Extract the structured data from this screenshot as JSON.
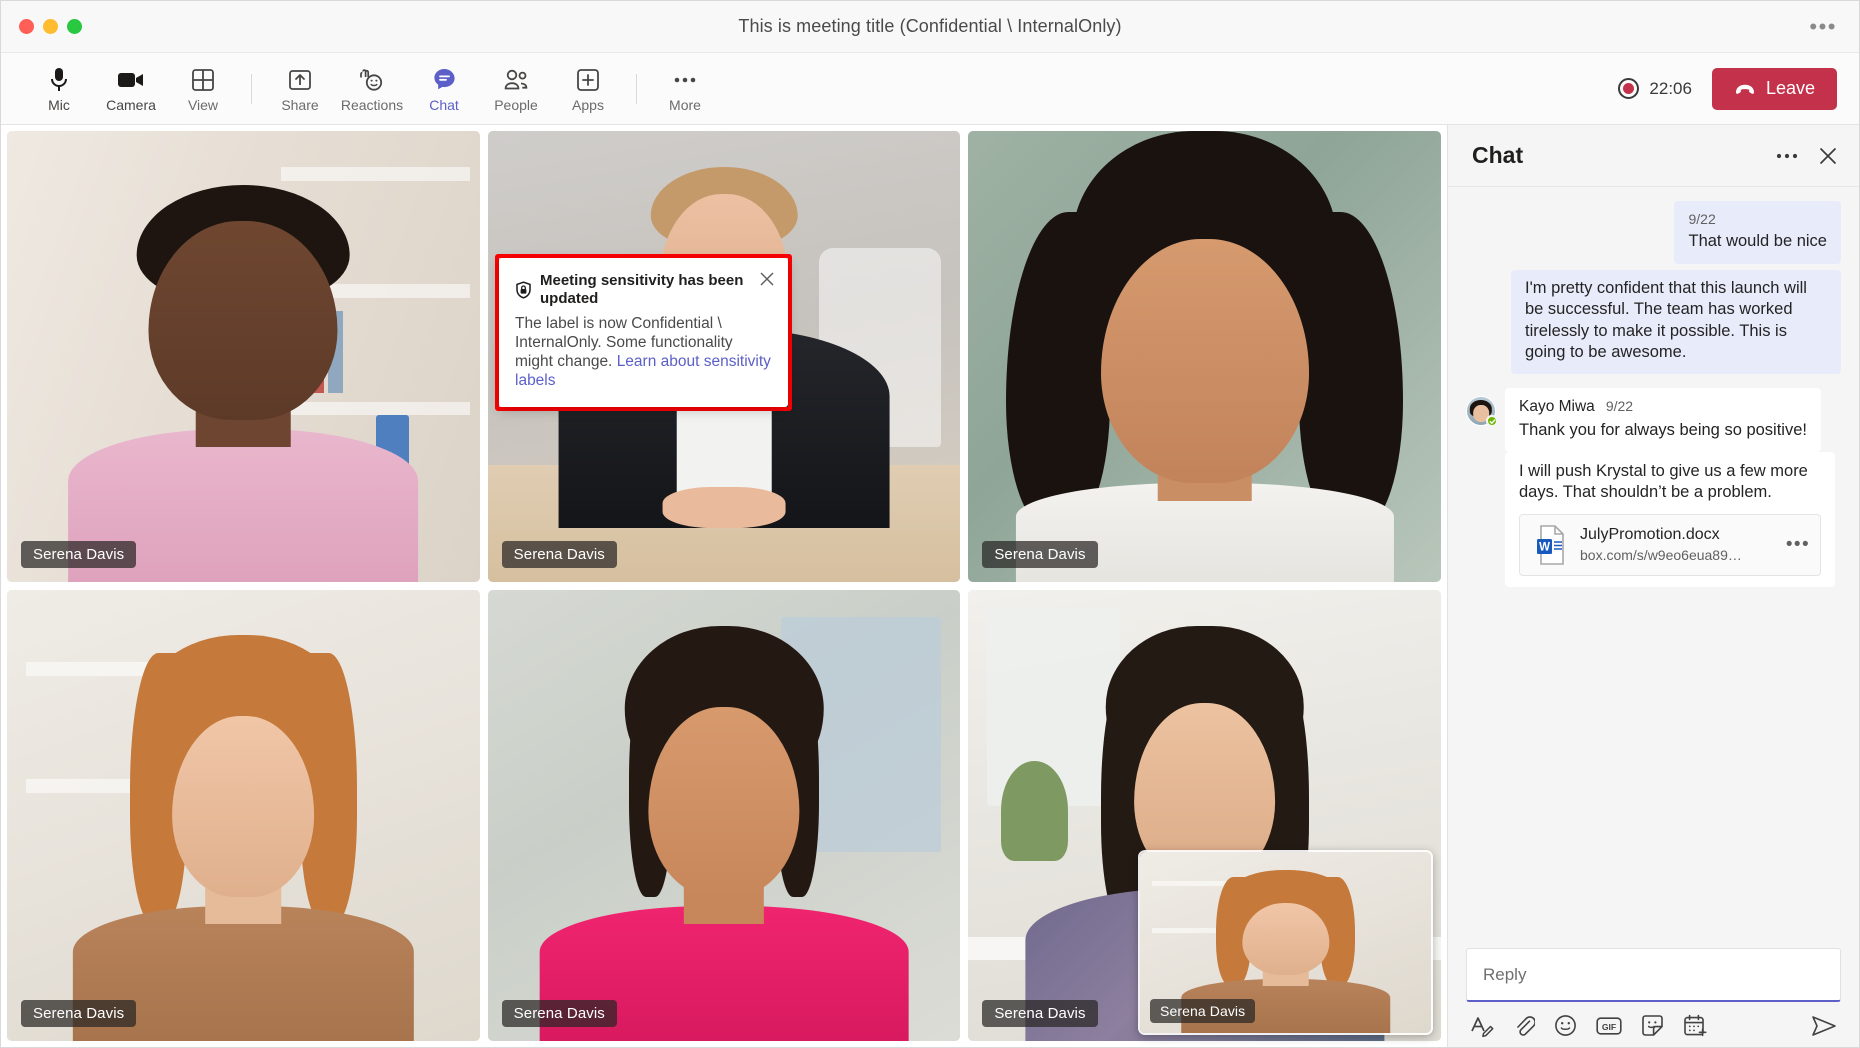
{
  "window": {
    "title": "This is meeting title (Confidential \\ InternalOnly)",
    "more_label": "•••"
  },
  "toolbar": {
    "items": [
      {
        "label": "Mic",
        "icon": "mic-icon",
        "state": "normal"
      },
      {
        "label": "Camera",
        "icon": "camera-icon",
        "state": "normal"
      },
      {
        "label": "View",
        "icon": "grid-view-icon",
        "state": "muted"
      },
      {
        "label": "Share",
        "icon": "share-icon",
        "state": "muted"
      },
      {
        "label": "Reactions",
        "icon": "reactions-icon",
        "state": "muted"
      },
      {
        "label": "Chat",
        "icon": "chat-icon",
        "state": "active"
      },
      {
        "label": "People",
        "icon": "people-icon",
        "state": "muted"
      },
      {
        "label": "Apps",
        "icon": "apps-icon",
        "state": "muted"
      },
      {
        "label": "More",
        "icon": "more-icon",
        "state": "muted"
      }
    ],
    "recording_time": "22:06",
    "leave_label": "Leave",
    "accent_purple": "#5B5FC7",
    "leave_red": "#C4314B",
    "record_red": "#C4314B"
  },
  "stage": {
    "tiles": [
      {
        "name": "Serena Davis",
        "scene": "s1"
      },
      {
        "name": "Serena Davis",
        "scene": "s2"
      },
      {
        "name": "Serena Davis",
        "scene": "s3"
      },
      {
        "name": "Serena Davis",
        "scene": "s4"
      },
      {
        "name": "Serena Davis",
        "scene": "s5"
      },
      {
        "name": "Serena Davis",
        "scene": "s6"
      }
    ],
    "pip": {
      "name": "Serena Davis",
      "scene": "s4"
    }
  },
  "toast": {
    "icon": "shield-lock-icon",
    "title": "Meeting sensitivity has been updated",
    "body_text": "The label is now Confidential \\ InternalOnly. Some functionality might change. ",
    "link_text": "Learn about sensitivity labels",
    "close_icon": "close-icon",
    "highlight_color": "#FF0000",
    "link_color": "#5B5FC7"
  },
  "chat": {
    "title": "Chat",
    "more_icon": "more-icon",
    "close_icon": "close-icon",
    "messages": [
      {
        "kind": "outgoing",
        "timestamp": "9/22",
        "text": "That would be nice"
      },
      {
        "kind": "outgoing",
        "timestamp": "",
        "text": "I'm pretty confident that this launch will be successful. The team has worked tirelessly to make it possible. This is going to be awesome."
      },
      {
        "kind": "incoming",
        "sender": "Kayo Miwa",
        "timestamp": "9/22",
        "text": "Thank you for always being so positive!",
        "presence": "available"
      },
      {
        "kind": "incoming-continued",
        "text": "I will push Krystal to give us a few more days. That shouldn’t be a problem.",
        "attachment": {
          "filename": "JulyPromotion.docx",
          "url": "box.com/s/w9eo6eua89…",
          "icon": "word-doc-icon",
          "more_icon": "more-icon"
        }
      }
    ],
    "compose": {
      "placeholder": "Reply",
      "value": "",
      "buttons": [
        {
          "name": "format-icon",
          "label": "Format"
        },
        {
          "name": "attach-icon",
          "label": "Attach"
        },
        {
          "name": "emoji-icon",
          "label": "Emoji"
        },
        {
          "name": "gif-icon",
          "label": "GIF"
        },
        {
          "name": "sticker-icon",
          "label": "Sticker"
        },
        {
          "name": "schedule-icon",
          "label": "Schedule"
        },
        {
          "name": "send-icon",
          "label": "Send"
        }
      ]
    }
  }
}
